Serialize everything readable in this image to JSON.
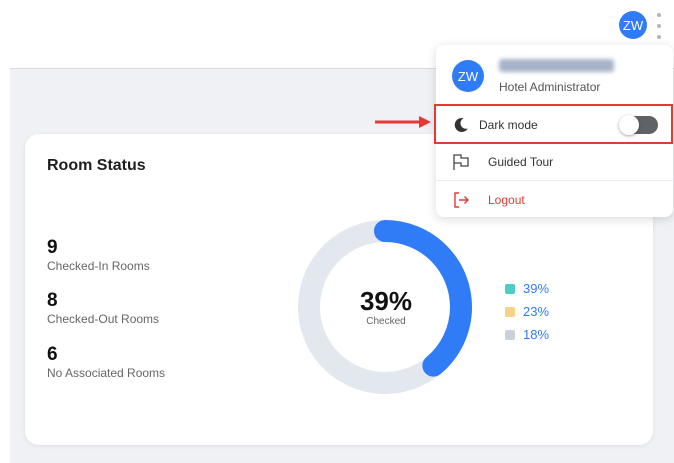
{
  "header": {
    "avatar_initials": "ZW"
  },
  "room_status": {
    "title": "Room Status",
    "stats": [
      {
        "value": "9",
        "label": "Checked-In Rooms"
      },
      {
        "value": "8",
        "label": "Checked-Out Rooms"
      },
      {
        "value": "6",
        "label": "No Associated Rooms"
      }
    ],
    "donut": {
      "percent_label": "39%",
      "sub_label": "Checked",
      "checked_fraction": 0.39,
      "progress_color": "#2f7cf6",
      "track_color": "#e3e7ee"
    },
    "legend": [
      {
        "label": "39%",
        "color": "#4ecdc4"
      },
      {
        "label": "23%",
        "color": "#f7d08a"
      },
      {
        "label": "18%",
        "color": "#c9d1dc"
      }
    ]
  },
  "user_menu": {
    "initials": "ZW",
    "role": "Hotel Administrator",
    "items": {
      "dark_mode": {
        "label": "Dark mode",
        "enabled": false
      },
      "guided_tour": {
        "label": "Guided Tour"
      },
      "logout": {
        "label": "Logout",
        "color": "#e53935"
      }
    }
  },
  "colors": {
    "accent": "#2f7cf6",
    "highlight": "#e53935"
  }
}
